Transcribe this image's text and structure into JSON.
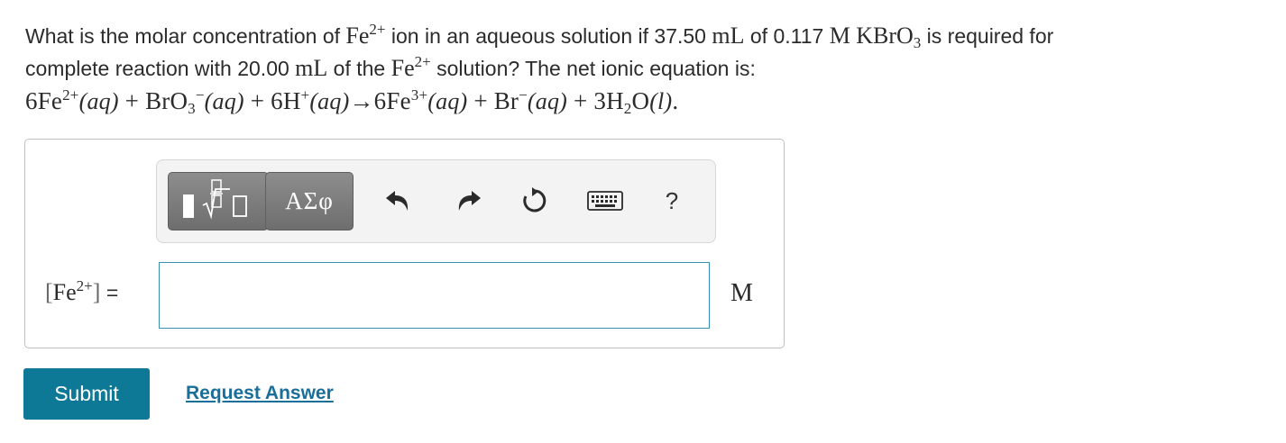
{
  "question": {
    "p1": "What is the molar concentration of ",
    "fe": "Fe",
    "charge2": "2+",
    "p2": " ion in an aqueous solution if 37.50 ",
    "unit_ml": "mL",
    "p3": " of 0.117 ",
    "unit_m": "M",
    "kbro": "KBrO",
    "sub3": "3",
    "p4": " is required for",
    "p5": "complete reaction with 20.00 ",
    "p6": " of the ",
    "p7": " solution? The net ionic equation is:"
  },
  "equation": {
    "t1": "6Fe",
    "c1": "2+",
    "aq": "(aq)",
    "plus": " + ",
    "bro": "BrO",
    "s3": "3",
    "minus": "−",
    "h": "6H",
    "cplus": "+",
    "arrow": "→",
    "fe3": "6Fe",
    "c3": "3+",
    "br": "Br",
    "h2o_a": "3H",
    "h2o_s": "2",
    "h2o_b": "O",
    "liq": "(l)",
    "end": "."
  },
  "toolbar": {
    "greek_label": "ΑΣφ",
    "help_label": "?"
  },
  "answer": {
    "label_open": "[",
    "label_fe": "Fe",
    "label_charge": "2+",
    "label_close": "]",
    "label_eq": " =",
    "value": "",
    "unit": "M"
  },
  "actions": {
    "submit_label": "Submit",
    "request_label": "Request Answer"
  },
  "colors": {
    "submit_bg": "#0e7897",
    "link": "#1a6f9a",
    "input_border": "#3b8fb4"
  }
}
